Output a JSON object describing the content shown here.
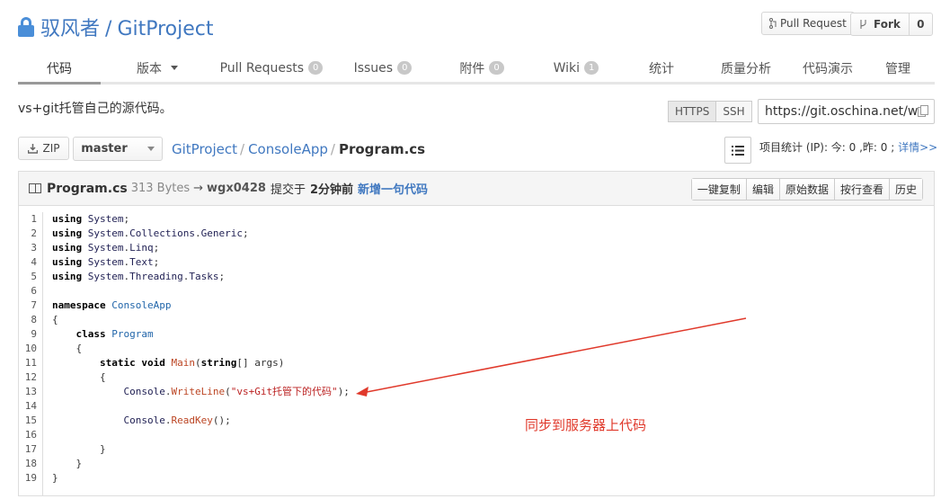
{
  "repo": {
    "owner": "驭风者",
    "separator": "/",
    "name": "GitProject"
  },
  "header_buttons": {
    "pull_request": "Pull Request",
    "fork": "Fork",
    "fork_count": "0"
  },
  "tabs": [
    {
      "label": "代码",
      "badge": ""
    },
    {
      "label": "版本",
      "badge": ""
    },
    {
      "label": "Pull Requests",
      "badge": "0"
    },
    {
      "label": "Issues",
      "badge": "0"
    },
    {
      "label": "附件",
      "badge": "0"
    },
    {
      "label": "Wiki",
      "badge": "1"
    },
    {
      "label": "统计",
      "badge": ""
    },
    {
      "label": "质量分析",
      "badge": ""
    },
    {
      "label": "代码演示",
      "badge": ""
    },
    {
      "label": "管理",
      "badge": ""
    }
  ],
  "description": "vs+git托管自己的源代码。",
  "clone": {
    "https": "HTTPS",
    "ssh": "SSH",
    "url": "https://git.oschina.net/w"
  },
  "path": {
    "zip": "ZIP",
    "branch": "master",
    "crumbs": [
      "GitProject",
      "ConsoleApp"
    ],
    "current": "Program.cs"
  },
  "stats": {
    "text": "项目统计 (IP): 今: 0 ,昨: 0 ;",
    "more": "详情>>"
  },
  "file": {
    "name": "Program.cs",
    "size": "313 Bytes",
    "arrow": "→",
    "user": "wgx0428",
    "committed": "提交于",
    "time": "2分钟前",
    "message": "新增一句代码"
  },
  "file_actions": [
    "一键复制",
    "编辑",
    "原始数据",
    "按行查看",
    "历史"
  ],
  "code_lines": [
    "using System;",
    "using System.Collections.Generic;",
    "using System.Linq;",
    "using System.Text;",
    "using System.Threading.Tasks;",
    "",
    "namespace ConsoleApp",
    "{",
    "    class Program",
    "    {",
    "        static void Main(string[] args)",
    "        {",
    "            Console.WriteLine(\"vs+Git托管下的代码\");",
    "",
    "            Console.ReadKey();",
    "",
    "        }",
    "    }",
    "}"
  ],
  "annotation": "同步到服务器上代码",
  "colors": {
    "link": "#4078c0",
    "annotation": "#e0392b",
    "lock": "#4a8ed8"
  },
  "icons": [
    "lock-icon",
    "pull-request-icon",
    "fork-icon",
    "download-icon",
    "list-icon",
    "copy-icon",
    "book-icon"
  ]
}
